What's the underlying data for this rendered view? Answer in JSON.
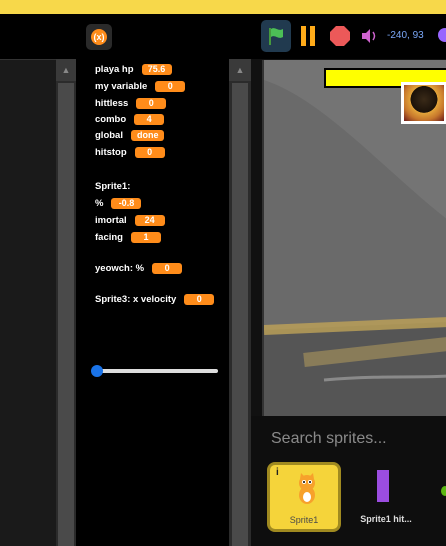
{
  "toolbar": {
    "coords": "-240, 93"
  },
  "variables": [
    {
      "label": "playa hp",
      "value": "75.6"
    },
    {
      "label": "my variable",
      "value": "0"
    },
    {
      "label": "hittless",
      "value": "0"
    },
    {
      "label": "combo",
      "value": "4"
    },
    {
      "label": "global",
      "value": "done"
    },
    {
      "label": "hitstop",
      "value": "0"
    },
    {
      "label": "Sprite1:",
      "value": null
    },
    {
      "label": "%",
      "value": "-0.8"
    },
    {
      "label": "imortal",
      "value": "24"
    },
    {
      "label": "facing",
      "value": "1"
    },
    {
      "label": "yeowch: %",
      "value": "0"
    },
    {
      "label": "Sprite3: x velocity",
      "value": "0"
    }
  ],
  "sprites": {
    "search_placeholder": "Search sprites...",
    "items": [
      {
        "name": "Sprite1",
        "selected": true
      },
      {
        "name": "Sprite1 hit..."
      }
    ]
  },
  "colors": {
    "accent": "#ff8c1a",
    "top_strip": "#f7d84a",
    "health_bar": "#ffff00",
    "selected_sprite": "#f5d43a"
  }
}
